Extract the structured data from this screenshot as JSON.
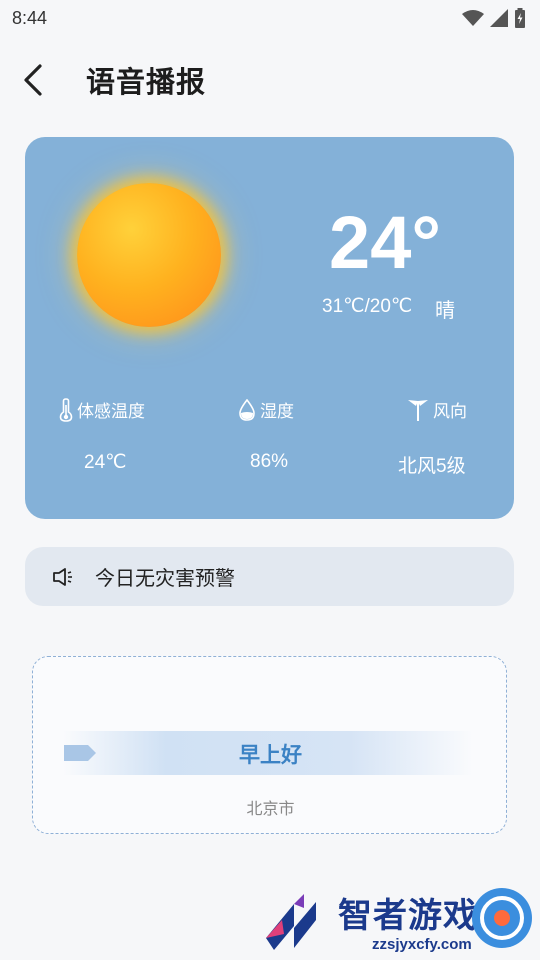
{
  "status_bar": {
    "time": "8:44",
    "icons": [
      "wifi-icon",
      "signal-icon",
      "battery-icon"
    ]
  },
  "header": {
    "back_icon": "chevron-left-icon",
    "title": "语音播报"
  },
  "weather": {
    "condition_icon": "sun-icon",
    "temperature": "24°",
    "range": "31℃/20℃",
    "condition": "晴",
    "metrics": [
      {
        "icon": "thermometer-icon",
        "label": "体感温度",
        "value": "24℃"
      },
      {
        "icon": "droplet-icon",
        "label": "湿度",
        "value": "86%"
      },
      {
        "icon": "wind-vane-icon",
        "label": "风向",
        "value": "北风5级"
      }
    ]
  },
  "alert": {
    "icon": "speaker-icon",
    "text": "今日无灾害预警"
  },
  "greeting": {
    "text": "早上好",
    "city": "北京市"
  },
  "watermark": {
    "text": "智者游戏网",
    "url": "zzsjyxcfy.com"
  },
  "colors": {
    "card_bg": "#84b1d8",
    "alert_bg": "#e2e8f0",
    "greeting_accent": "#3b82c4",
    "page_bg": "#f6f7f9"
  }
}
